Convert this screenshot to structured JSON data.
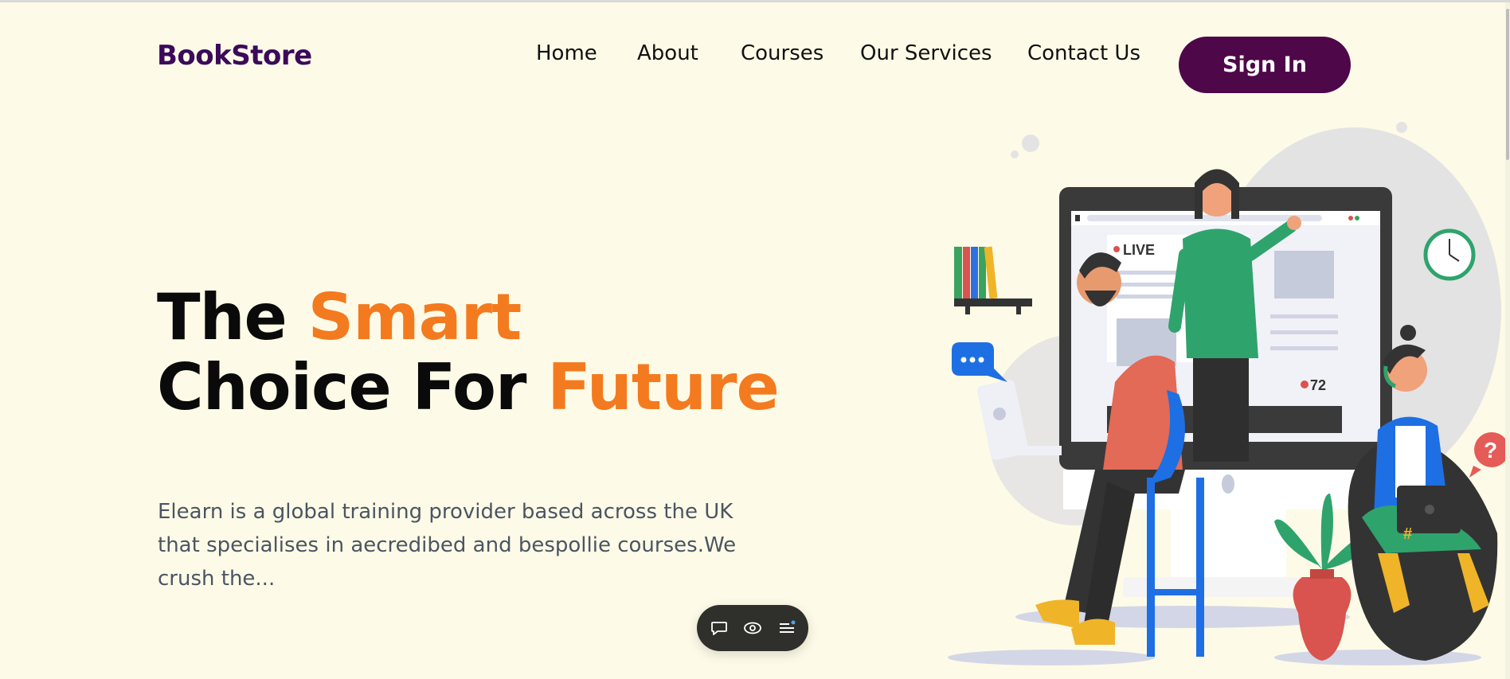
{
  "header": {
    "logo": "BookStore",
    "nav": [
      "Home",
      "About",
      "Courses",
      "Our Services",
      "Contact Us"
    ],
    "signin_label": "Sign In"
  },
  "hero": {
    "title_part1": "The ",
    "title_accent1": "Smart",
    "title_part2": "Choice For ",
    "title_accent2": "Future",
    "description": "Elearn is a global training provider based across the UK that specialises in aecredibed and bespollie courses.We crush the...",
    "accent_color": "#f47a1f"
  },
  "illustration": {
    "live_label": "LIVE",
    "viewer_count": "72"
  },
  "toolbar": {
    "icons": [
      "comment-icon",
      "eye-icon",
      "menu-icon"
    ]
  },
  "colors": {
    "background": "#fdfbe7",
    "brand": "#4e0749",
    "logo": "#3b0a5a"
  }
}
